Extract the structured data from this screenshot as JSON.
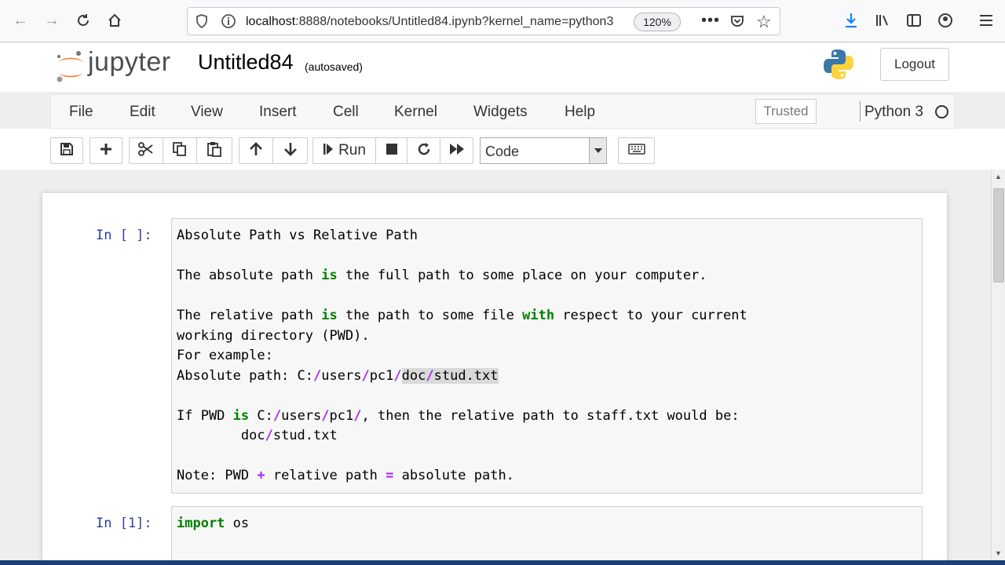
{
  "browser": {
    "url_host": "localhost",
    "url_rest": ":8888/notebooks/Untitled84.ipynb?kernel_name=python3",
    "zoom": "120%"
  },
  "header": {
    "logo_text": "jupyter",
    "notebook_name": "Untitled84",
    "autosave_status": "(autosaved)",
    "logout_label": "Logout"
  },
  "menu": {
    "items": [
      "File",
      "Edit",
      "View",
      "Insert",
      "Cell",
      "Kernel",
      "Widgets",
      "Help"
    ],
    "trusted_label": "Trusted",
    "kernel_name": "Python 3"
  },
  "toolbar": {
    "run_label": "Run",
    "cell_type": "Code"
  },
  "cells": [
    {
      "prompt": "In [ ]:",
      "lines": [
        "Absolute Path vs Relative Path",
        "",
        "The absolute path is the full path to some place on your computer.",
        "",
        "The relative path is the path to some file with respect to your current",
        "working directory (PWD).",
        "For example:",
        "Absolute path: C:/users/pc1/doc/stud.txt",
        "",
        "If PWD is C:/users/pc1/, then the relative path to staff.txt would be:",
        "        doc/stud.txt",
        "",
        "Note: PWD + relative path = absolute path."
      ]
    },
    {
      "prompt": "In [1]:",
      "lines": [
        "import os"
      ]
    }
  ],
  "colors": {
    "keyword": "#008000",
    "operator": "#aa22ff",
    "prompt": "#303f9f",
    "jupyter_orange": "#f37626"
  }
}
